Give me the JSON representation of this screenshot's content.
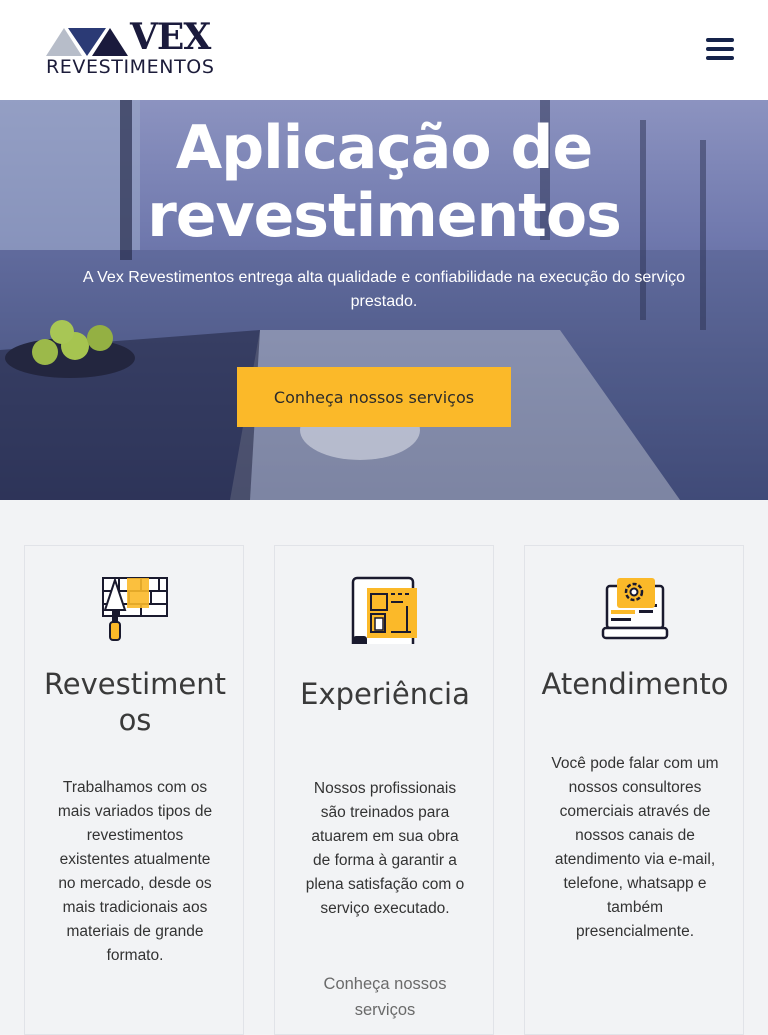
{
  "header": {
    "logo_brand": "VEX",
    "logo_subtitle": "REVESTIMENTOS",
    "menu_icon": "hamburger-menu-icon"
  },
  "hero": {
    "title_line1": "Aplicação de",
    "title_line2": "revestimentos",
    "subtitle_line1": "A Vex Revestimentos entrega alta qualidade e confiabilidade na execução do serviço",
    "subtitle_line2": "prestado.",
    "cta_label": "Conheça nossos serviços"
  },
  "cards": [
    {
      "icon": "brick-wall-trowel-icon",
      "title": "Revestimentos",
      "text": "Trabalhamos com os mais variados tipos de revestimentos existentes atualmente no mercado, desde os mais tradicionais aos materiais de grande formato."
    },
    {
      "icon": "blueprint-plan-icon",
      "title": "Experiência",
      "text": "Nossos profissionais são treinados para atuarem em sua obra de forma à garantir a plena satisfação com o serviço executado.",
      "link": "Conheça nossos serviços"
    },
    {
      "icon": "laptop-support-gear-icon",
      "title": "Atendimento",
      "text": "Você pode falar com um nossos consultores comerciais através de nossos canais de atendimento via e-mail, telefone, whatsapp e também presencialmente."
    }
  ],
  "colors": {
    "accent": "#fbb929",
    "navy": "#15234a",
    "background": "#f2f3f5"
  }
}
